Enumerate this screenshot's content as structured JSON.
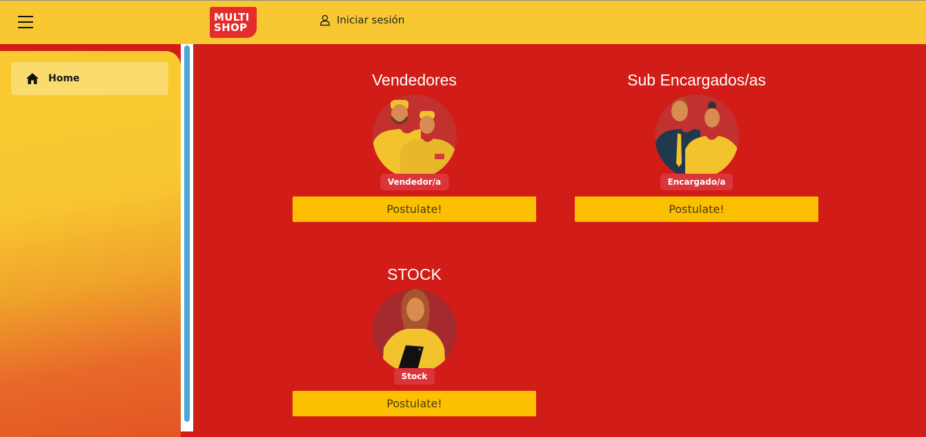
{
  "header": {
    "logo_line1": "MULTI",
    "logo_line2": "SHOP",
    "login_label": "Iniciar sesión"
  },
  "sidebar": {
    "items": [
      {
        "label": "Home",
        "icon": "home-icon"
      }
    ]
  },
  "cards": [
    {
      "title": "Vendedores",
      "badge": "Vendedor/a",
      "button_label": "Postulate!"
    },
    {
      "title": "Sub Encargados/as",
      "badge": "Encargado/a",
      "button_label": "Postulate!"
    },
    {
      "title": "STOCK",
      "badge": "Stock",
      "button_label": "Postulate!"
    }
  ],
  "colors": {
    "header_bg": "#f8c832",
    "main_bg": "#d21c17",
    "button_bg": "#fdc000",
    "logo_bg": "#e42c2a",
    "badge_bg": "#db353a"
  }
}
